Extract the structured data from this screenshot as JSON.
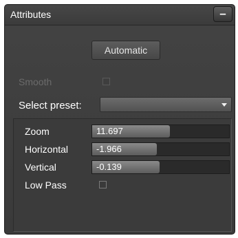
{
  "panel": {
    "title": "Attributes",
    "collapse_label": "–"
  },
  "automatic_button": {
    "label": "Automatic"
  },
  "smooth": {
    "label": "Smooth",
    "checked": false,
    "enabled": false
  },
  "preset": {
    "label": "Select preset:",
    "value": ""
  },
  "sliders": [
    {
      "label": "Zoom",
      "value": "11.697",
      "fill_fraction": 0.57
    },
    {
      "label": "Horizontal",
      "value": "-1.966",
      "fill_fraction": 0.47
    },
    {
      "label": "Vertical",
      "value": "-0.139",
      "fill_fraction": 0.49
    }
  ],
  "low_pass": {
    "label": "Low Pass",
    "checked": false
  }
}
